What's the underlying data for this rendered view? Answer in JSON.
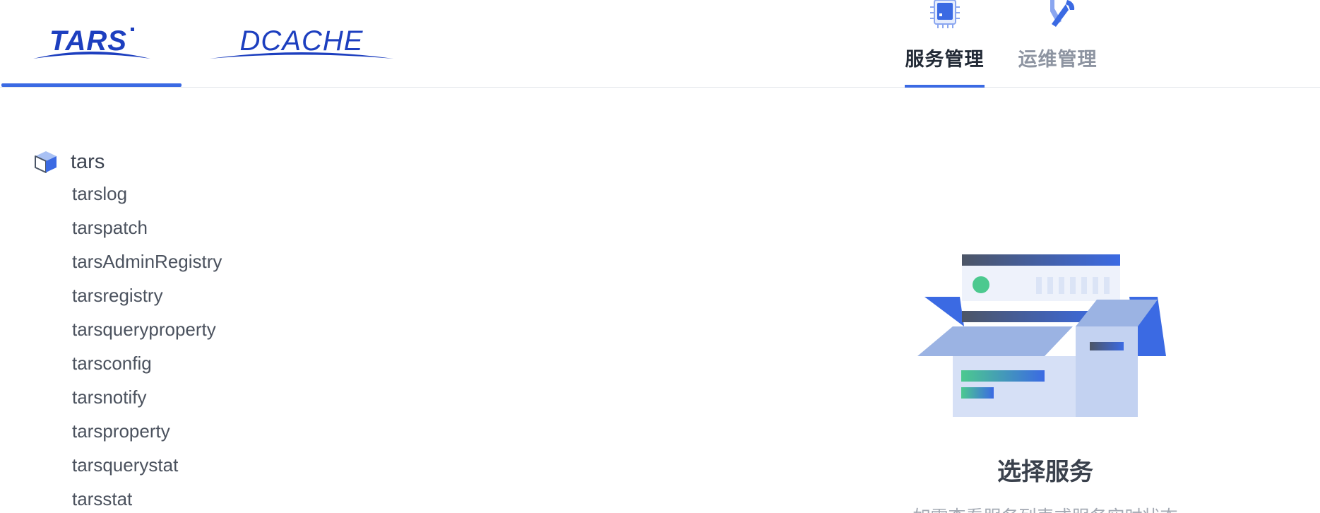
{
  "brands": {
    "tars": "TARS",
    "dcache": "DCACHE"
  },
  "nav": {
    "tabs": [
      {
        "label": "服务管理",
        "active": true,
        "icon": "chip-icon"
      },
      {
        "label": "运维管理",
        "active": false,
        "icon": "wrench-icon"
      }
    ]
  },
  "tree": {
    "root": "tars",
    "items": [
      "tarslog",
      "tarspatch",
      "tarsAdminRegistry",
      "tarsregistry",
      "tarsqueryproperty",
      "tarsconfig",
      "tarsnotify",
      "tarsproperty",
      "tarsquerystat",
      "tarsstat"
    ]
  },
  "empty_state": {
    "title": "选择服务",
    "description": "如需查看服务列表或服务实时状态"
  },
  "colors": {
    "accent": "#3b6ae3",
    "text_dark": "#222a36",
    "text_muted": "#8d94a1"
  }
}
